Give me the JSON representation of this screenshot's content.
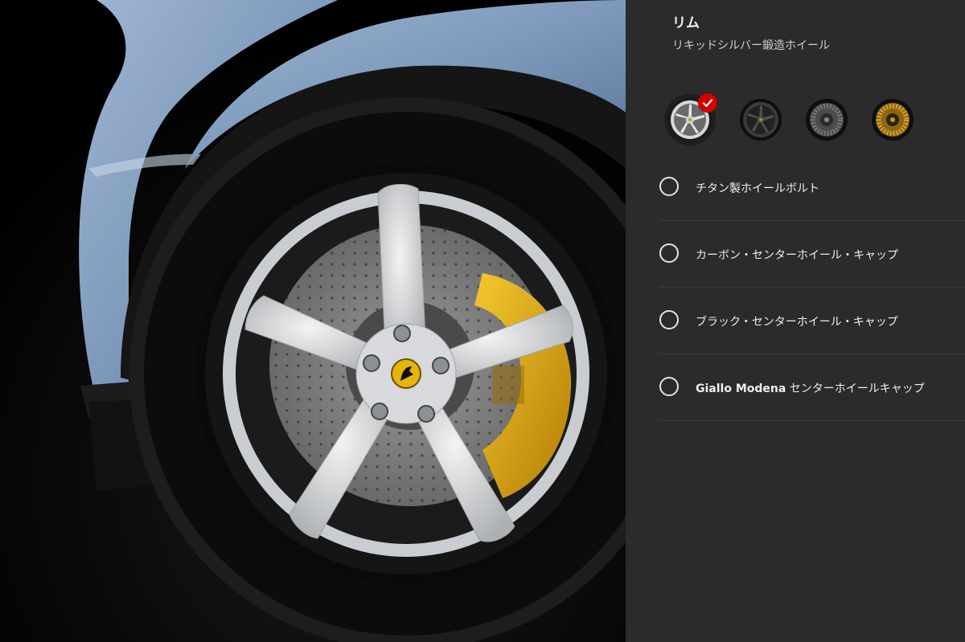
{
  "panel": {
    "title": "リム",
    "subtitle": "リキッドシルバー鍛造ホイール"
  },
  "rims": [
    {
      "name": "liquid-silver-forged-rim",
      "color": "#cfd2d4",
      "selected": true
    },
    {
      "name": "dark-grey-rim",
      "color": "#3b3c3d",
      "selected": false
    },
    {
      "name": "grey-multispoke-rim",
      "color": "#4a4b4c",
      "selected": false
    },
    {
      "name": "gold-multispoke-rim",
      "color": "#b88a2a",
      "selected": false
    }
  ],
  "options": [
    {
      "label": "チタン製ホイールボルト",
      "checked": false
    },
    {
      "label": "カーボン・センターホイール・キャップ",
      "checked": false
    },
    {
      "label": "ブラック・センターホイール・キャップ",
      "checked": false
    },
    {
      "label_brand": "Giallo Modena",
      "label": " センターホイールキャップ",
      "checked": false
    }
  ],
  "colors": {
    "body_paint": "#7e99bb",
    "caliper": "#e6ad12",
    "accent_check": "#d40000",
    "panel_bg": "#2b2b2b"
  }
}
